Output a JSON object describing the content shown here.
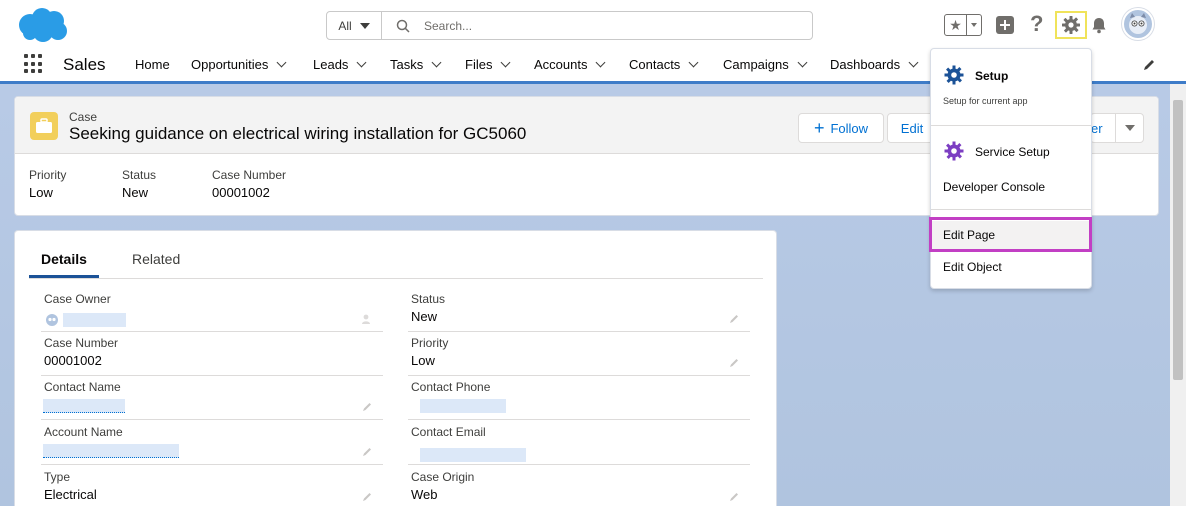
{
  "header": {
    "search": {
      "scope": "All",
      "placeholder": "Search..."
    },
    "icons": [
      "cloud-logo-icon",
      "favorites-star-icon",
      "global-actions-plus-icon",
      "help-question-icon",
      "setup-gear-icon",
      "notifications-bell-icon",
      "user-avatar-icon"
    ]
  },
  "nav": {
    "app_name": "Sales",
    "items": [
      {
        "label": "Home"
      },
      {
        "label": "Opportunities"
      },
      {
        "label": "Leads"
      },
      {
        "label": "Tasks"
      },
      {
        "label": "Files"
      },
      {
        "label": "Accounts"
      },
      {
        "label": "Contacts"
      },
      {
        "label": "Campaigns"
      },
      {
        "label": "Dashboards"
      }
    ]
  },
  "record": {
    "object_label": "Case",
    "title": "Seeking guidance on electrical wiring installation for GC5060",
    "buttons": {
      "follow": "Follow",
      "edit": "Edit",
      "more_partial": "er"
    },
    "highlights": [
      {
        "label": "Priority",
        "value": "Low"
      },
      {
        "label": "Status",
        "value": "New"
      },
      {
        "label": "Case Number",
        "value": "00001002"
      }
    ]
  },
  "details": {
    "tabs": {
      "details": "Details",
      "related": "Related"
    },
    "fields_left": [
      {
        "label": "Case Owner",
        "value": ""
      },
      {
        "label": "Case Number",
        "value": "00001002"
      },
      {
        "label": "Contact Name",
        "value": ""
      },
      {
        "label": "Account Name",
        "value": ""
      },
      {
        "label": "Type",
        "value": "Electrical"
      }
    ],
    "fields_right": [
      {
        "label": "Status",
        "value": "New"
      },
      {
        "label": "Priority",
        "value": "Low"
      },
      {
        "label": "Contact Phone",
        "value": ""
      },
      {
        "label": "Contact Email",
        "value": ""
      },
      {
        "label": "Case Origin",
        "value": "Web"
      }
    ]
  },
  "setup_menu": {
    "setup": "Setup",
    "setup_sub": "Setup for current app",
    "service_setup": "Service Setup",
    "developer_console": "Developer Console",
    "edit_page": "Edit Page",
    "edit_object": "Edit Object"
  },
  "colors": {
    "brand_blue": "#0070d2",
    "nav_accent": "#3e7cc8",
    "background": "#b0c4df",
    "case_icon": "#f2cf5b",
    "highlight_box": "#c23fc4",
    "gear_highlight": "#f0e35a"
  }
}
